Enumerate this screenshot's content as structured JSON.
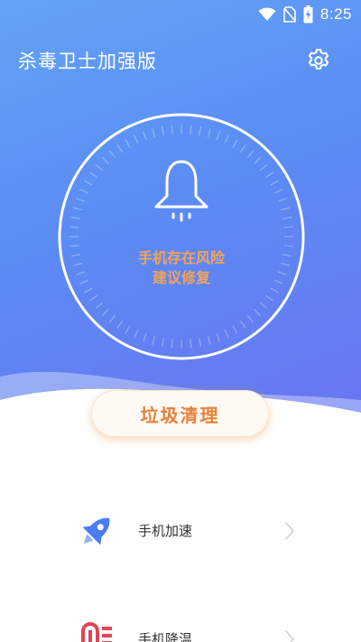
{
  "status_bar": {
    "time": "8:25",
    "icons": [
      "wifi-icon",
      "no-sim-icon",
      "battery-charging-icon"
    ]
  },
  "header": {
    "title": "杀毒卫士加强版",
    "settings_icon": "gear-icon"
  },
  "dial": {
    "icon": "bell-icon",
    "status_line1": "手机存在风险",
    "status_line2": "建议修复"
  },
  "primary_action": {
    "label": "垃圾清理"
  },
  "menu": {
    "items": [
      {
        "label": "手机加速",
        "icon": "rocket-icon"
      },
      {
        "label": "手机降温",
        "icon": "thermometer-icon"
      }
    ]
  },
  "colors": {
    "hero_start": "#62a3f7",
    "hero_end": "#6a74f0",
    "accent_orange": "#f2a35c",
    "button_text": "#e6803a",
    "rocket_blue": "#4a7ef0",
    "thermo_red": "#e04656"
  }
}
